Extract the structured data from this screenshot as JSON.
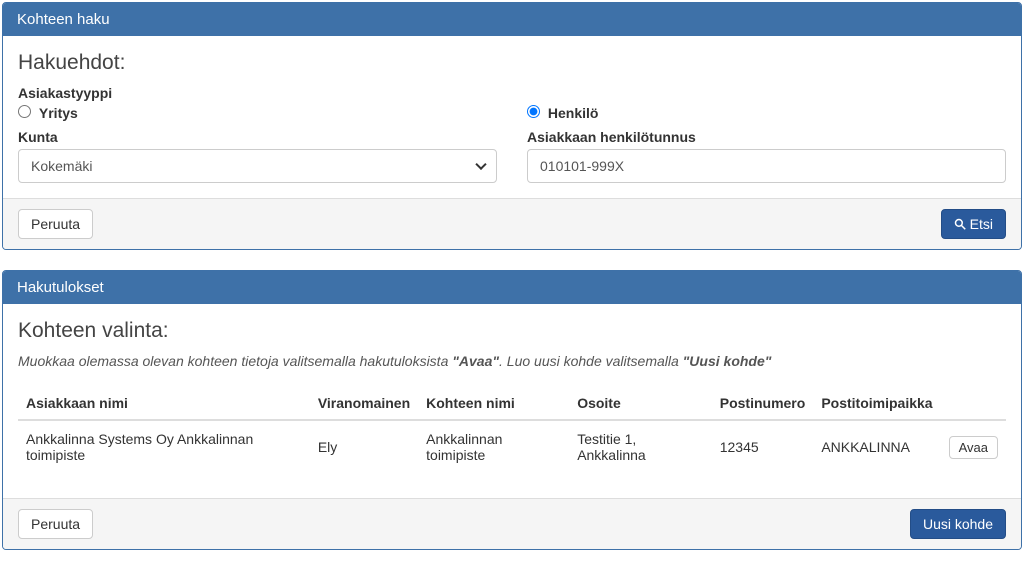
{
  "search_panel": {
    "title": "Kohteen haku",
    "section": "Hakuehdot:",
    "customer_type_label": "Asiakastyyppi",
    "radio_company": "Yritys",
    "radio_person": "Henkilö",
    "municipality_label": "Kunta",
    "municipality_value": "Kokemäki",
    "ssn_label": "Asiakkaan henkilötunnus",
    "ssn_value": "010101-999X",
    "cancel_btn": "Peruuta",
    "search_btn": "Etsi"
  },
  "results_panel": {
    "title": "Hakutulokset",
    "section": "Kohteen valinta:",
    "help_prefix": "Muokkaa olemassa olevan kohteen tietoja valitsemalla hakutuloksista ",
    "help_bold1": "\"Avaa\"",
    "help_mid": ". Luo uusi kohde valitsemalla ",
    "help_bold2": "\"Uusi kohde\"",
    "columns": {
      "name": "Asiakkaan nimi",
      "authority": "Viranomainen",
      "target": "Kohteen nimi",
      "address": "Osoite",
      "postcode": "Postinumero",
      "postoffice": "Postitoimipaikka"
    },
    "rows": [
      {
        "name": "Ankkalinna Systems Oy Ankkalinnan toimipiste",
        "authority": "Ely",
        "target": "Ankkalinnan toimipiste",
        "address": "Testitie 1, Ankkalinna",
        "postcode": "12345",
        "postoffice": "ANKKALINNA"
      }
    ],
    "open_btn": "Avaa",
    "cancel_btn": "Peruuta",
    "new_btn": "Uusi kohde"
  }
}
